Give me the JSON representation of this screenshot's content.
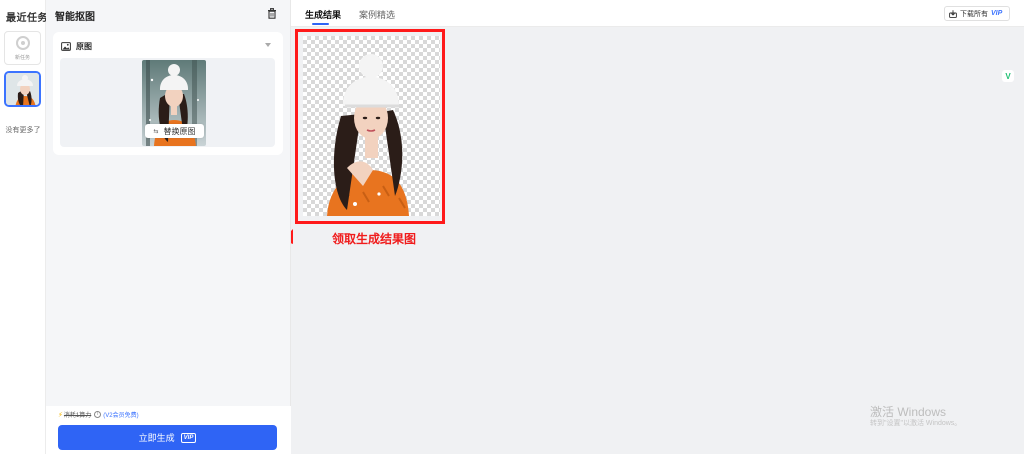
{
  "history": {
    "title": "最近任务",
    "new_task_label": "新任务",
    "no_more": "没有更多了"
  },
  "panel": {
    "title": "智能抠图",
    "section_label": "原图",
    "replace_label": "替换原图",
    "credit": {
      "cost_label": "消耗1算力",
      "vip_note": "(V2会员免费)"
    },
    "generate_label": "立即生成",
    "generate_badge": "VIP"
  },
  "main": {
    "tabs": [
      {
        "label": "生成结果",
        "active": true
      },
      {
        "label": "案例精选",
        "active": false
      }
    ],
    "download_label": "下载所有",
    "download_badge": "VIP",
    "annotation": "领取生成结果图",
    "side_icon_glyph": "V"
  },
  "watermark": {
    "title": "激活 Windows",
    "subtitle": "转到\"设置\"以激活 Windows。"
  },
  "colors": {
    "accent": "#2f64f5",
    "annotation": "#ff1a1a",
    "sweater": "#e8741f"
  }
}
